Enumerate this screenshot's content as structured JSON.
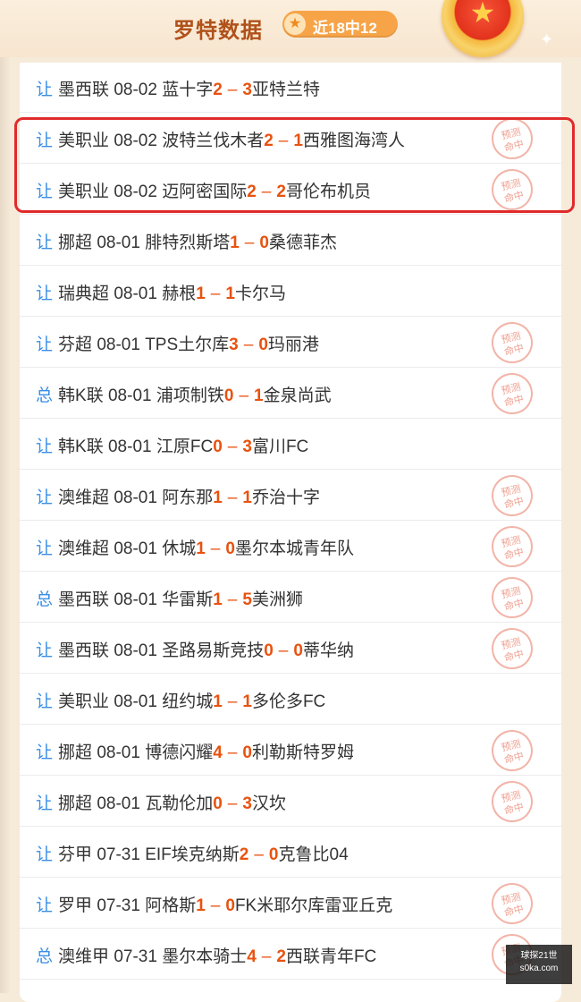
{
  "header": {
    "title": "罗特数据",
    "rate_label": "近18中12",
    "star_icon": "star-icon",
    "medal_icon": "medal-icon"
  },
  "stamp_text": [
    "预测",
    "命中"
  ],
  "matches": [
    {
      "type": "让",
      "league": "墨西联",
      "date": "08-02",
      "home": "蓝十字",
      "home_score": "2",
      "away_score": "3",
      "away": "亚特兰特",
      "hit": false
    },
    {
      "type": "让",
      "league": "美职业",
      "date": "08-02",
      "home": "波特兰伐木者",
      "home_score": "2",
      "away_score": "1",
      "away": "西雅图海湾人",
      "hit": true
    },
    {
      "type": "让",
      "league": "美职业",
      "date": "08-02",
      "home": "迈阿密国际",
      "home_score": "2",
      "away_score": "2",
      "away": "哥伦布机员",
      "hit": true
    },
    {
      "type": "让",
      "league": "挪超",
      "date": "08-01",
      "home": "腓特烈斯塔",
      "home_score": "1",
      "away_score": "0",
      "away": "桑德菲杰",
      "hit": false
    },
    {
      "type": "让",
      "league": "瑞典超",
      "date": "08-01",
      "home": "赫根",
      "home_score": "1",
      "away_score": "1",
      "away": "卡尔马",
      "hit": false
    },
    {
      "type": "让",
      "league": "芬超",
      "date": "08-01",
      "home": "TPS土尔库",
      "home_score": "3",
      "away_score": "0",
      "away": "玛丽港",
      "hit": true
    },
    {
      "type": "总",
      "league": "韩K联",
      "date": "08-01",
      "home": "浦项制铁",
      "home_score": "0",
      "away_score": "1",
      "away": "金泉尚武",
      "hit": true
    },
    {
      "type": "让",
      "league": "韩K联",
      "date": "08-01",
      "home": "江原FC",
      "home_score": "0",
      "away_score": "3",
      "away": "富川FC",
      "hit": false
    },
    {
      "type": "让",
      "league": "澳维超",
      "date": "08-01",
      "home": "阿东那",
      "home_score": "1",
      "away_score": "1",
      "away": "乔治十字",
      "hit": true
    },
    {
      "type": "让",
      "league": "澳维超",
      "date": "08-01",
      "home": "休城",
      "home_score": "1",
      "away_score": "0",
      "away": "墨尔本城青年队",
      "hit": true
    },
    {
      "type": "总",
      "league": "墨西联",
      "date": "08-01",
      "home": "华雷斯",
      "home_score": "1",
      "away_score": "5",
      "away": "美洲狮",
      "hit": true
    },
    {
      "type": "让",
      "league": "墨西联",
      "date": "08-01",
      "home": "圣路易斯竞技",
      "home_score": "0",
      "away_score": "0",
      "away": "蒂华纳",
      "hit": true
    },
    {
      "type": "让",
      "league": "美职业",
      "date": "08-01",
      "home": "纽约城",
      "home_score": "1",
      "away_score": "1",
      "away": "多伦多FC",
      "hit": false
    },
    {
      "type": "让",
      "league": "挪超",
      "date": "08-01",
      "home": "博德闪耀",
      "home_score": "4",
      "away_score": "0",
      "away": "利勒斯特罗姆",
      "hit": true
    },
    {
      "type": "让",
      "league": "挪超",
      "date": "08-01",
      "home": "瓦勒伦加",
      "home_score": "0",
      "away_score": "3",
      "away": "汉坎",
      "hit": true
    },
    {
      "type": "让",
      "league": "芬甲",
      "date": "07-31",
      "home": "EIF埃克纳斯",
      "home_score": "2",
      "away_score": "0",
      "away": "克鲁比04",
      "hit": false
    },
    {
      "type": "让",
      "league": "罗甲",
      "date": "07-31",
      "home": "阿格斯",
      "home_score": "1",
      "away_score": "0",
      "away": "FK米耶尔库雷亚丘克",
      "hit": true
    },
    {
      "type": "总",
      "league": "澳维甲",
      "date": "07-31",
      "home": "墨尔本骑士",
      "home_score": "4",
      "away_score": "2",
      "away": "西联青年FC",
      "hit": true
    }
  ],
  "watermark": {
    "line1": "球探21世",
    "line2": "s0ka.com"
  }
}
